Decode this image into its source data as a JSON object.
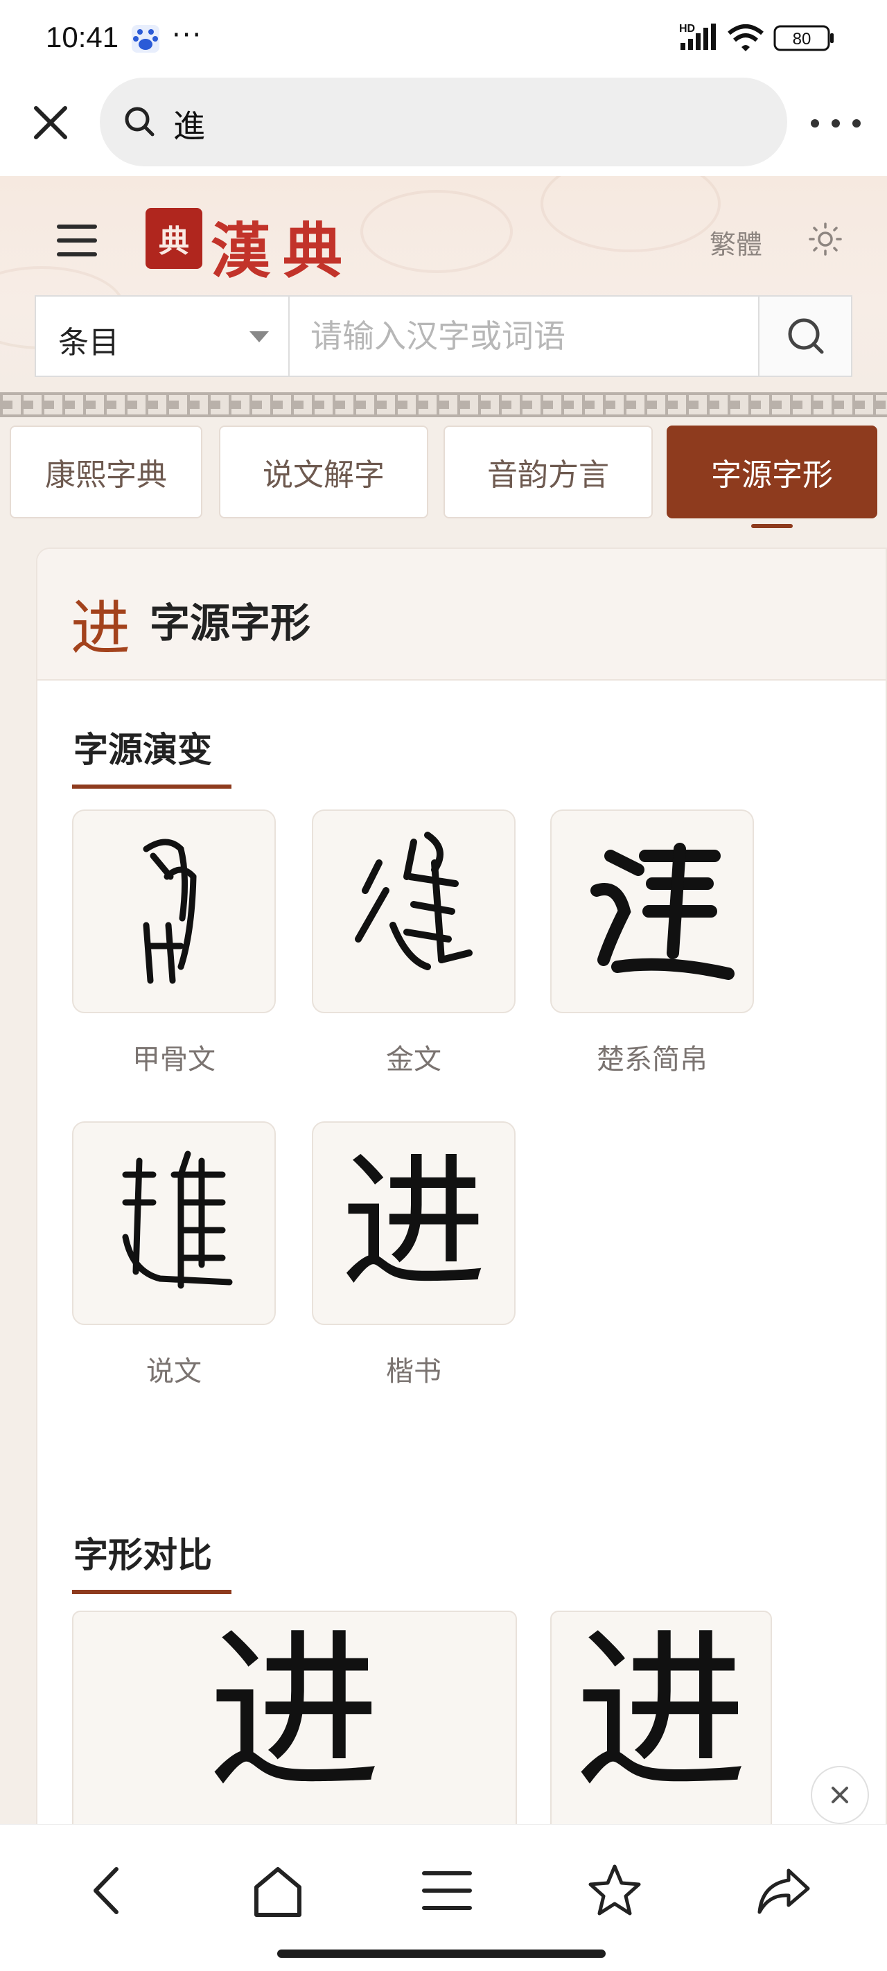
{
  "status_bar": {
    "time": "10:41",
    "network_label": "HD",
    "battery": "80"
  },
  "browser": {
    "query": "進",
    "icons": [
      "close-icon",
      "search-icon",
      "more-icon"
    ]
  },
  "site": {
    "seal_text": "典",
    "logo_text": "漢典",
    "trad_label": "繁體",
    "search_scope": "条目",
    "search_placeholder": "请输入汉字或词语"
  },
  "tabs": [
    {
      "label": "康熙字典",
      "active": false
    },
    {
      "label": "说文解字",
      "active": false
    },
    {
      "label": "音韵方言",
      "active": false
    },
    {
      "label": "字源字形",
      "active": true
    }
  ],
  "card": {
    "char": "进",
    "title": "字源字形",
    "evolution": {
      "title": "字源演变",
      "items": [
        {
          "caption": "甲骨文",
          "glyph": "oracle-bone"
        },
        {
          "caption": "金文",
          "glyph": "bronze"
        },
        {
          "caption": "楚系简帛",
          "glyph": "chu-bamboo"
        },
        {
          "caption": "说文",
          "glyph": "shuowen-seal"
        },
        {
          "caption": "楷书",
          "glyph": "进"
        }
      ]
    },
    "compare": {
      "title": "字形对比",
      "glyphs": [
        "进",
        "进"
      ]
    }
  },
  "colors": {
    "accent": "#8e3b1e",
    "logo_red": "#c2332a"
  }
}
